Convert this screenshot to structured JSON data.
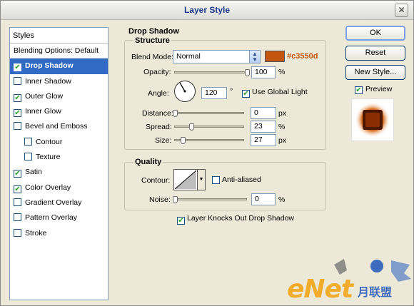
{
  "window": {
    "title": "Layer Style",
    "close_glyph": "✕"
  },
  "styles_panel": {
    "header": "Styles",
    "items": [
      {
        "label": "Blending Options: Default",
        "checkbox": false,
        "checked": false,
        "selected": false,
        "sub": false
      },
      {
        "label": "Drop Shadow",
        "checkbox": true,
        "checked": true,
        "selected": true,
        "sub": false
      },
      {
        "label": "Inner Shadow",
        "checkbox": true,
        "checked": false,
        "selected": false,
        "sub": false
      },
      {
        "label": "Outer Glow",
        "checkbox": true,
        "checked": true,
        "selected": false,
        "sub": false
      },
      {
        "label": "Inner Glow",
        "checkbox": true,
        "checked": true,
        "selected": false,
        "sub": false
      },
      {
        "label": "Bevel and Emboss",
        "checkbox": true,
        "checked": false,
        "selected": false,
        "sub": false
      },
      {
        "label": "Contour",
        "checkbox": true,
        "checked": false,
        "selected": false,
        "sub": true
      },
      {
        "label": "Texture",
        "checkbox": true,
        "checked": false,
        "selected": false,
        "sub": true
      },
      {
        "label": "Satin",
        "checkbox": true,
        "checked": true,
        "selected": false,
        "sub": false
      },
      {
        "label": "Color Overlay",
        "checkbox": true,
        "checked": true,
        "selected": false,
        "sub": false
      },
      {
        "label": "Gradient Overlay",
        "checkbox": true,
        "checked": false,
        "selected": false,
        "sub": false
      },
      {
        "label": "Pattern Overlay",
        "checkbox": true,
        "checked": false,
        "selected": false,
        "sub": false
      },
      {
        "label": "Stroke",
        "checkbox": true,
        "checked": false,
        "selected": false,
        "sub": false
      }
    ]
  },
  "drop_shadow": {
    "section_title": "Drop Shadow",
    "structure_title": "Structure",
    "blend_mode_label": "Blend Mode:",
    "blend_mode_value": "Normal",
    "shadow_color": "#c3550d",
    "shadow_color_text": "#c3550d",
    "opacity_label": "Opacity:",
    "opacity_value": "100",
    "opacity_unit": "%",
    "angle_label": "Angle:",
    "angle_value": "120",
    "angle_unit": "°",
    "use_global_light_label": "Use Global Light",
    "use_global_light_checked": true,
    "distance_label": "Distance:",
    "distance_value": "0",
    "distance_unit": "px",
    "spread_label": "Spread:",
    "spread_value": "23",
    "spread_unit": "%",
    "size_label": "Size:",
    "size_value": "27",
    "size_unit": "px"
  },
  "quality": {
    "title": "Quality",
    "contour_label": "Contour:",
    "anti_aliased_label": "Anti-aliased",
    "anti_aliased_checked": false,
    "noise_label": "Noise:",
    "noise_value": "0",
    "noise_unit": "%",
    "knocks_out_label": "Layer Knocks Out Drop Shadow",
    "knocks_out_checked": true
  },
  "buttons": {
    "ok": "OK",
    "reset": "Reset",
    "new_style": "New Style...",
    "preview_label": "Preview",
    "preview_checked": true
  },
  "watermark": {
    "text": "eNet",
    "text2": "月联盟"
  },
  "colors": {
    "accent": "#316ac5",
    "shadow": "#c3550d",
    "window_bg": "#ece9d8"
  }
}
